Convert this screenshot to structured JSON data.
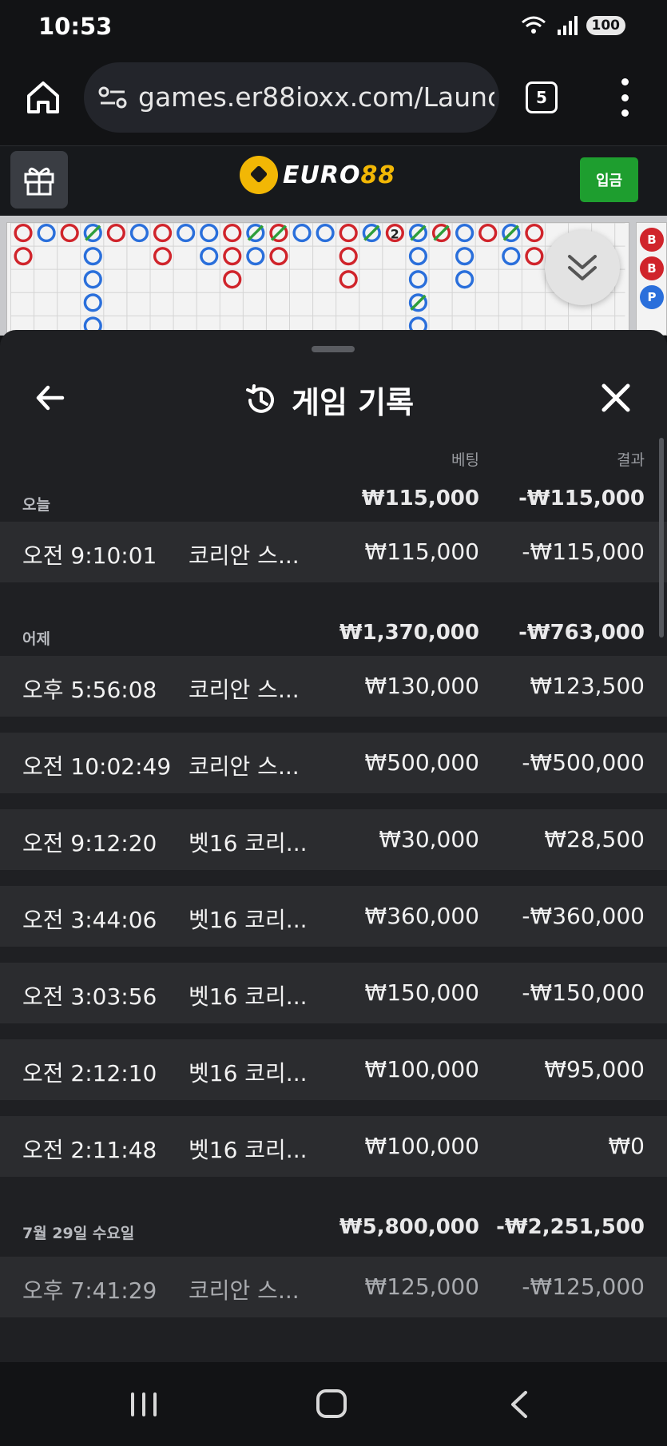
{
  "status_bar": {
    "time": "10:53",
    "battery": "100"
  },
  "browser": {
    "url": "games.er88ioxx.com/Launcl",
    "tab_count": "5"
  },
  "site_header": {
    "logo_main": "EURO",
    "logo_accent": "88",
    "deposit_label": "입금"
  },
  "board": {
    "marker_number": "2",
    "side_labels": [
      "B",
      "B",
      "P"
    ]
  },
  "sheet": {
    "title": "게임 기록",
    "col_bet": "베팅",
    "col_result": "결과",
    "days": [
      {
        "label": "오늘",
        "bet_total": "₩115,000",
        "result_total": "-₩115,000",
        "rows": [
          {
            "time": "오전 9:10:01",
            "game": "코리안 스...",
            "bet": "₩115,000",
            "result": "-₩115,000"
          }
        ]
      },
      {
        "label": "어제",
        "bet_total": "₩1,370,000",
        "result_total": "-₩763,000",
        "rows": [
          {
            "time": "오후 5:56:08",
            "game": "코리안 스...",
            "bet": "₩130,000",
            "result": "₩123,500"
          },
          {
            "time": "오전 10:02:49",
            "game": "코리안 스...",
            "bet": "₩500,000",
            "result": "-₩500,000"
          },
          {
            "time": "오전 9:12:20",
            "game": "벳16 코리...",
            "bet": "₩30,000",
            "result": "₩28,500"
          },
          {
            "time": "오전 3:44:06",
            "game": "벳16 코리...",
            "bet": "₩360,000",
            "result": "-₩360,000"
          },
          {
            "time": "오전 3:03:56",
            "game": "벳16 코리...",
            "bet": "₩150,000",
            "result": "-₩150,000"
          },
          {
            "time": "오전 2:12:10",
            "game": "벳16 코리...",
            "bet": "₩100,000",
            "result": "₩95,000"
          },
          {
            "time": "오전 2:11:48",
            "game": "벳16 코리...",
            "bet": "₩100,000",
            "result": "₩0"
          }
        ]
      },
      {
        "label": "7월 29일 수요일",
        "bet_total": "₩5,800,000",
        "result_total": "-₩2,251,500",
        "rows": [
          {
            "time": "오후 7:41:29",
            "game": "코리안 스...",
            "bet": "₩125,000",
            "result": "-₩125,000"
          }
        ]
      }
    ]
  },
  "colors": {
    "accent": "#f2b705",
    "deposit": "#1e9e2f",
    "banker": "#d0242b",
    "player": "#2a6fdb",
    "tie": "#2e9e3a"
  },
  "icons": [
    "home-icon",
    "site-settings-icon",
    "gift-icon",
    "soccer-ball-icon",
    "chevron-double-down-icon",
    "back-arrow-icon",
    "history-icon",
    "close-icon"
  ]
}
